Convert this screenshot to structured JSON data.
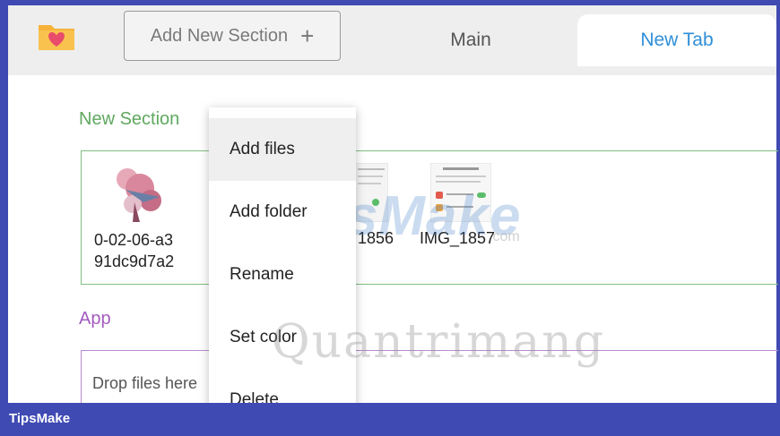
{
  "toolbar": {
    "add_section_label": "Add New Section",
    "add_icon": "+"
  },
  "tabs": [
    {
      "label": "Main"
    },
    {
      "label": "New Tab"
    }
  ],
  "sections": [
    {
      "title": "New Section",
      "files": [
        {
          "name_line1": "0-02-06-a3",
          "name_line2": "91dc9d7a2"
        },
        {
          "name": "1856"
        },
        {
          "name": "IMG_1857"
        }
      ]
    },
    {
      "title": "App",
      "drop_hint": "Drop files here"
    }
  ],
  "context_menu": {
    "items": [
      "Add files",
      "Add folder",
      "Rename",
      "Set color",
      "Delete"
    ]
  },
  "watermarks": {
    "tips": "TipsMake",
    "dotcom": ".com",
    "quantrimang": "Quantrimang"
  },
  "footer": {
    "brand": "TipsMake"
  },
  "colors": {
    "frame": "#3f4ab3",
    "section_green": "#5fa85f",
    "section_purple": "#a35bc0",
    "tab_active": "#2f8fd8"
  }
}
